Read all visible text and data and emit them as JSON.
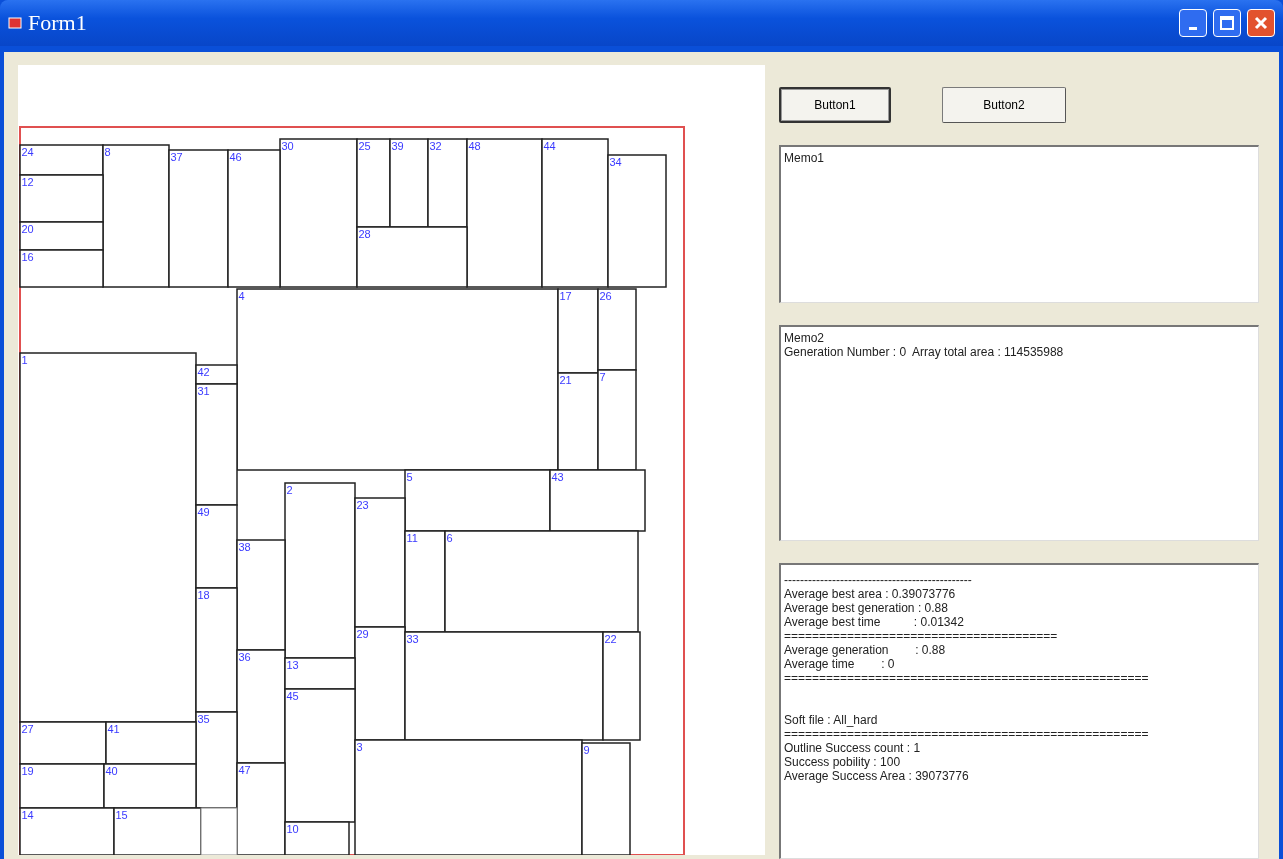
{
  "window": {
    "title": "Form1"
  },
  "canvas": {
    "blocks": [
      {
        "label": "30"
      },
      {
        "label": "25"
      },
      {
        "label": "39"
      },
      {
        "label": "32"
      },
      {
        "label": "48"
      },
      {
        "label": "44"
      },
      {
        "label": "24"
      },
      {
        "label": "8"
      },
      {
        "label": "37"
      },
      {
        "label": "46"
      },
      {
        "label": "34"
      },
      {
        "label": "12"
      },
      {
        "label": "20"
      },
      {
        "label": "28"
      },
      {
        "label": "16"
      },
      {
        "label": "4"
      },
      {
        "label": "17"
      },
      {
        "label": "26"
      },
      {
        "label": "1"
      },
      {
        "label": "42"
      },
      {
        "label": "21"
      },
      {
        "label": "7"
      },
      {
        "label": "31"
      },
      {
        "label": "5"
      },
      {
        "label": "43"
      },
      {
        "label": "2"
      },
      {
        "label": "23"
      },
      {
        "label": "49"
      },
      {
        "label": "11"
      },
      {
        "label": "6"
      },
      {
        "label": "38"
      },
      {
        "label": "18"
      },
      {
        "label": "29"
      },
      {
        "label": "33"
      },
      {
        "label": "22"
      },
      {
        "label": "36"
      },
      {
        "label": "13"
      },
      {
        "label": "45"
      },
      {
        "label": "35"
      },
      {
        "label": "27"
      },
      {
        "label": "41"
      },
      {
        "label": "3"
      },
      {
        "label": "9"
      },
      {
        "label": "19"
      },
      {
        "label": "40"
      },
      {
        "label": "47"
      },
      {
        "label": "14"
      },
      {
        "label": "15"
      },
      {
        "label": "10"
      }
    ]
  },
  "buttons": [
    {
      "label": "Button1",
      "focused": true
    },
    {
      "label": "Button2",
      "focused": false
    }
  ],
  "memos": [
    {
      "lines": [
        {
          "text": "Memo1"
        }
      ]
    },
    {
      "lines": [
        {
          "text": "Memo2"
        },
        {
          "text": "Generation Number : 0  Array total area : 114535988"
        }
      ]
    },
    {
      "lines": [
        {
          "kind": "text",
          "text": "-----------------------------------------------"
        },
        {
          "kind": "text",
          "text": "Average best area : 0.39073776"
        },
        {
          "kind": "text",
          "text": "Average best generation : 0.88"
        },
        {
          "kind": "text",
          "text": "Average best time          : 0.01342"
        },
        {
          "kind": "text",
          "text": "======================================="
        },
        {
          "kind": "text",
          "text": "Average generation        : 0.88"
        },
        {
          "kind": "text",
          "text": "Average time        : 0"
        },
        {
          "kind": "text",
          "text": "===================================================="
        },
        {
          "kind": "blank"
        },
        {
          "kind": "blank"
        },
        {
          "kind": "text",
          "text": "Soft file : All_hard"
        },
        {
          "kind": "text",
          "text": "===================================================="
        },
        {
          "kind": "text",
          "text": "Outline Success count : 1"
        },
        {
          "kind": "text",
          "text": "Success pobility : 100"
        },
        {
          "kind": "text",
          "text": "Average Success Area : 39073776"
        }
      ]
    }
  ]
}
